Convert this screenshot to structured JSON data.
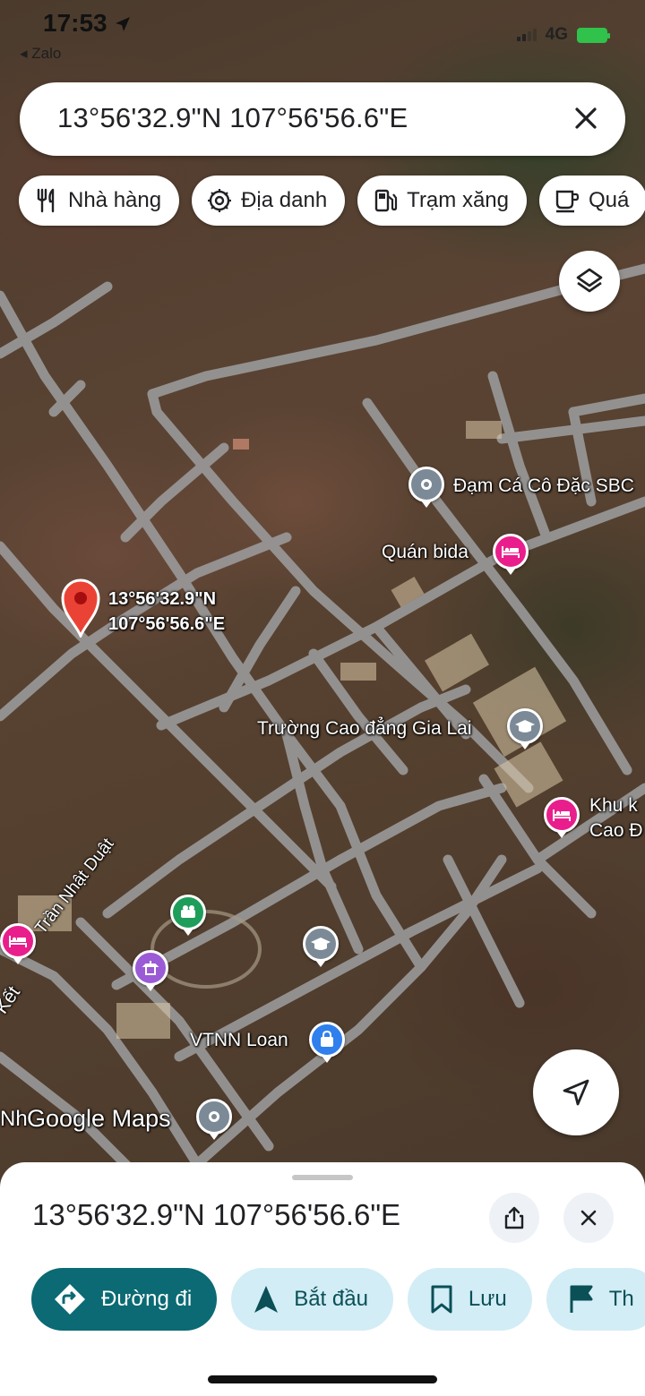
{
  "status_bar": {
    "time": "17:53",
    "back_app": "◂ Zalo",
    "network": "4G"
  },
  "search": {
    "query": "13°56'32.9\"N 107°56'56.6\"E"
  },
  "chips": [
    {
      "label": "Nhà hàng",
      "icon": "restaurant-icon"
    },
    {
      "label": "Địa danh",
      "icon": "landmark-icon"
    },
    {
      "label": "Trạm xăng",
      "icon": "gas-station-icon"
    },
    {
      "label": "Quá",
      "icon": "cafe-icon"
    }
  ],
  "map": {
    "dropped_pin": {
      "lat": "13°56'32.9\"N",
      "lng": "107°56'56.6\"E"
    },
    "places": {
      "dam_ca": "Đạm Cá Cô Đặc SBC",
      "quan_bida": "Quán bida",
      "truong": "Trường Cao đẳng Gia Lai",
      "khu_k_1": "Khu k",
      "khu_k_2": "Cao Đ",
      "vtnn": "VTNN Loan",
      "road": "Trần Nhật Duật",
      "ket": "Kết",
      "nh": "Nh"
    },
    "watermark": "Google Maps"
  },
  "sheet": {
    "title": "13°56'32.9\"N 107°56'56.6\"E",
    "actions": [
      {
        "label": "Đường đi",
        "icon": "directions-icon"
      },
      {
        "label": "Bắt đầu",
        "icon": "navigation-icon"
      },
      {
        "label": "Lưu",
        "icon": "bookmark-icon"
      },
      {
        "label": "Th",
        "icon": "flag-icon"
      }
    ]
  },
  "colors": {
    "primary": "#0b6a73",
    "secondary_button": "#d2edf5",
    "pin_red": "#ea4335",
    "lodging_pink": "#e91e8c"
  }
}
